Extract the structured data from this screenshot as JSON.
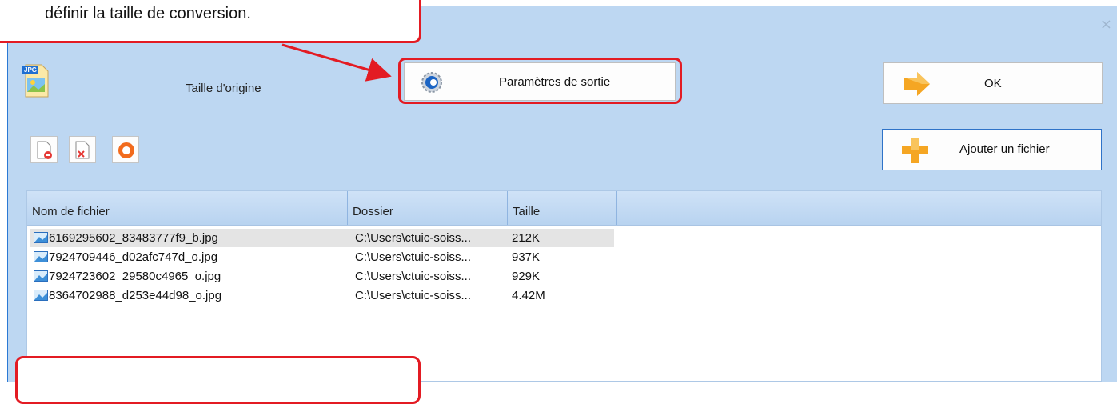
{
  "annotation": {
    "callout_text": "définir la taille de conversion.",
    "highlight_color": "#e31b23"
  },
  "window": {
    "close_glyph": "×",
    "accent": "#2b79d4",
    "background": "#bdd7f2"
  },
  "top": {
    "source_icon": "jpg-file-icon",
    "source_icon_text": "JPG",
    "origin_label": "Taille d'origine",
    "params_button": {
      "label": "Paramètres de sortie",
      "icon": "settings-gear-icon"
    },
    "ok_button": {
      "label": "OK",
      "icon": "arrow-right-icon"
    },
    "add_button": {
      "label": "Ajouter un fichier",
      "icon": "plus-icon"
    }
  },
  "toolbar": {
    "buttons": [
      {
        "icon": "remove-file-icon"
      },
      {
        "icon": "clear-list-icon"
      },
      {
        "icon": "start-convert-icon"
      }
    ]
  },
  "file_list": {
    "columns": [
      "Nom de fichier",
      "Dossier",
      "Taille"
    ],
    "rows": [
      {
        "name": "6169295602_83483777f9_b.jpg",
        "folder": "C:\\Users\\ctuic-soiss...",
        "size": "212K",
        "selected": true
      },
      {
        "name": "7924709446_d02afc747d_o.jpg",
        "folder": "C:\\Users\\ctuic-soiss...",
        "size": "937K",
        "selected": false
      },
      {
        "name": "7924723602_29580c4965_o.jpg",
        "folder": "C:\\Users\\ctuic-soiss...",
        "size": "929K",
        "selected": false
      },
      {
        "name": "8364702988_d253e44d98_o.jpg",
        "folder": "C:\\Users\\ctuic-soiss...",
        "size": "4.42M",
        "selected": false
      }
    ]
  }
}
